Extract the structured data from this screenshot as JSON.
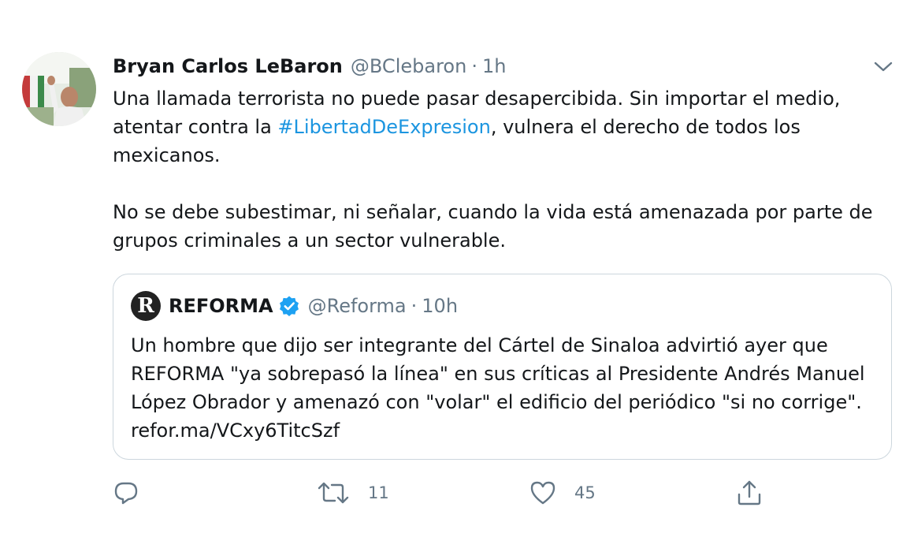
{
  "tweet": {
    "author_name": "Bryan Carlos LeBaron",
    "author_handle": "@BClebaron",
    "separator": "·",
    "time": "1h",
    "text_line1_before": "Una llamada terrorista no puede pasar desapercibida. Sin importar el medio, atentar contra la ",
    "hashtag": "#LibertadDeExpresion",
    "text_line1_after": ", vulnera el derecho de todos los mexicanos.",
    "text_paragraph2": "No se debe subestimar, ni señalar, cuando la vida está amenazada por parte de grupos criminales a un sector vulnerable."
  },
  "quoted": {
    "logo_letter": "R",
    "name": "REFORMA",
    "verified": true,
    "handle": "@Reforma",
    "separator": "·",
    "time": "10h",
    "text": "Un hombre que dijo ser integrante del Cártel de Sinaloa advirtió ayer que REFORMA \"ya sobrepasó la línea\" en sus críticas al Presidente Andrés Manuel López Obrador y amenazó con \"volar\" el edificio del periódico \"si no corrige\". refor.ma/VCxy6TitcSzf"
  },
  "actions": {
    "reply_icon": "reply-icon",
    "retweet_icon": "retweet-icon",
    "retweet_count": "11",
    "like_icon": "heart-icon",
    "like_count": "45",
    "share_icon": "share-icon"
  },
  "colors": {
    "link": "#1b95e0",
    "muted": "#657786",
    "text": "#14171a",
    "border": "#ccd6dd",
    "verified": "#1da1f2"
  }
}
